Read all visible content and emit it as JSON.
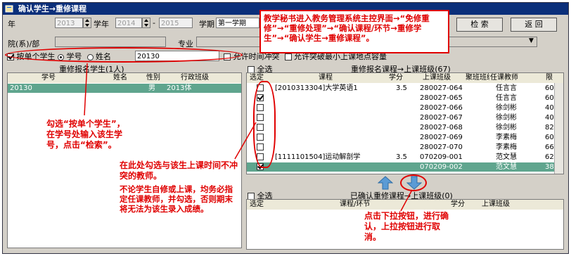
{
  "window": {
    "title": "确认学生→重修课程"
  },
  "filters": {
    "year_label": "年",
    "year_value": "2013",
    "academic_year_label": "学年",
    "academic_year_from": "2014",
    "academic_year_to": "2015",
    "semester_label": "学期",
    "semester_value": "第一学期",
    "dept_label": "院(系)/部",
    "major_label": "专业",
    "search_button": "检 索",
    "back_button": "返 回"
  },
  "options": {
    "by_single_student": "按单个学生",
    "student_no_label": "学号",
    "name_label": "姓名",
    "student_no_value": "20130",
    "allow_time_conflict": "允许时间冲突",
    "allow_exceed_capacity": "允许突破最小上课地点容量"
  },
  "left_panel": {
    "title": "重修报名学生(1人)",
    "columns": [
      "学号",
      "姓名",
      "性别",
      "行政班级"
    ],
    "rows": [
      {
        "student_no": "20130",
        "name": "",
        "gender": "男",
        "class": "2013体"
      }
    ]
  },
  "right_top_panel": {
    "select_all": "全选",
    "title": "重修报名课程→上课班级(67)",
    "columns": [
      "选定",
      "课程",
      "学分",
      "上课班级",
      "聚班班级",
      "任课教师",
      "限"
    ],
    "rows": [
      {
        "checked": false,
        "course": "[2010313304]大学英语1",
        "credit": "3.5",
        "class": "280027-064",
        "teacher": "任言言",
        "limit": "60"
      },
      {
        "checked": true,
        "course": "",
        "credit": "",
        "class": "280027-065",
        "teacher": "任言言",
        "limit": "60"
      },
      {
        "checked": false,
        "course": "",
        "credit": "",
        "class": "280027-066",
        "teacher": "徐剑彬",
        "limit": "40"
      },
      {
        "checked": false,
        "course": "",
        "credit": "",
        "class": "280027-067",
        "teacher": "徐剑彬",
        "limit": "40"
      },
      {
        "checked": false,
        "course": "",
        "credit": "",
        "class": "280027-068",
        "teacher": "徐剑彬",
        "limit": "82"
      },
      {
        "checked": false,
        "course": "",
        "credit": "",
        "class": "280027-069",
        "teacher": "李素梅",
        "limit": "60"
      },
      {
        "checked": false,
        "course": "",
        "credit": "",
        "class": "280027-070",
        "teacher": "李素梅",
        "limit": "66"
      },
      {
        "checked": false,
        "course": "[1111101504]运动解剖学",
        "credit": "3.5",
        "class": "070209-001",
        "teacher": "范文慧",
        "limit": "62"
      },
      {
        "checked": true,
        "course": "",
        "credit": "",
        "class": "070209-002",
        "teacher": "范文慧",
        "limit": "38"
      }
    ]
  },
  "right_bottom_panel": {
    "select_all": "全选",
    "title": "已确认重修课程→上课班级(0)",
    "columns": [
      "选定",
      "课程/环节",
      "学分",
      "上课班级"
    ]
  },
  "annotations": {
    "top_box": "教学秘书进入教务管理系统主控界面→“免修重修”→“重修处理”→“确认课程/环节→重修学生”→“确认学生→重修课程”。",
    "left_note": "勾选“按单个学生”，在学号处输入该生学号，点击“检索”。",
    "mid_note": "在此处勾选与该生上课时间不冲突的教师。",
    "warn_note": "不论学生自修或上课，均务必指定任课教师，并勾选，否则期末将无法为该生录入成绩。",
    "bottom_note": "点击下拉按钮，进行确认，上拉按钮进行取消。"
  },
  "colors": {
    "title_bar": "#0b2f7a",
    "annotation_red": "#e00000",
    "selected_row": "#5fa58e",
    "arrow_blue": "#5b9bd5"
  }
}
